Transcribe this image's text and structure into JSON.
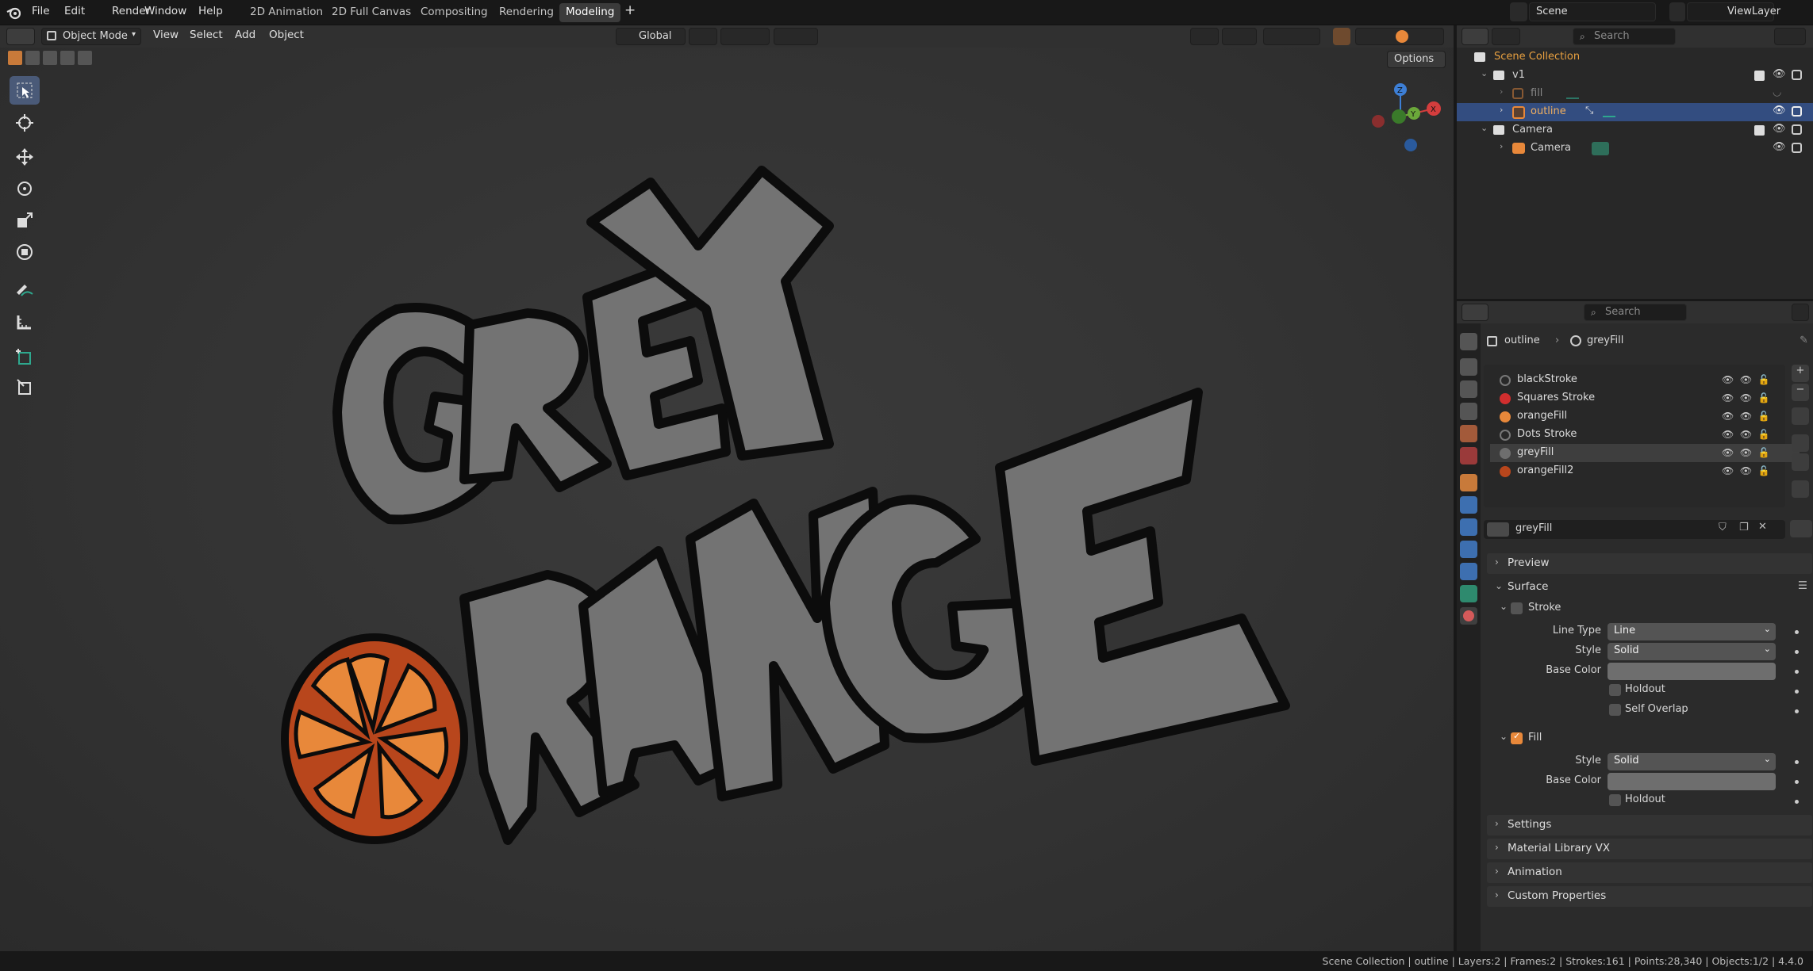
{
  "menu": [
    "File",
    "Edit",
    "Render",
    "Window",
    "Help"
  ],
  "workspaces": [
    "2D Animation",
    "2D Full Canvas",
    "Compositing",
    "Rendering",
    "Modeling"
  ],
  "active_workspace": "Modeling",
  "add_tab": "+",
  "scene": {
    "label": "Scene",
    "view_layer": "ViewLayer"
  },
  "viewport_header": {
    "mode": "Object Mode",
    "menus": [
      "View",
      "Select",
      "Add",
      "Object"
    ],
    "orientation": "Global",
    "options": "Options"
  },
  "gizmo": {
    "z": "Z",
    "y": "Y",
    "x": "X"
  },
  "outliner": {
    "search_placeholder": "Search",
    "rows": [
      {
        "label": "Scene Collection"
      },
      {
        "label": "v1"
      },
      {
        "label": "fill"
      },
      {
        "label": "outline"
      },
      {
        "label": "Camera"
      },
      {
        "label": "Camera"
      }
    ]
  },
  "properties": {
    "search_placeholder": "Search",
    "breadcrumb": {
      "object": "outline",
      "material": "greyFill"
    },
    "materials": [
      {
        "name": "blackStroke",
        "color": "#1a1a1a"
      },
      {
        "name": "Squares Stroke",
        "color": "#d12e2e"
      },
      {
        "name": "orangeFill",
        "color": "#e8883a"
      },
      {
        "name": "Dots Stroke",
        "color": "#1a1a1a"
      },
      {
        "name": "greyFill",
        "color": "#6e6e6e"
      },
      {
        "name": "orangeFill2",
        "color": "#b8461c"
      }
    ],
    "active_material": "greyFill",
    "sections": {
      "preview": "Preview",
      "surface": "Surface",
      "stroke": "Stroke",
      "fill": "Fill",
      "settings": "Settings",
      "library": "Material Library VX",
      "animation": "Animation",
      "custom": "Custom Properties"
    },
    "stroke": {
      "line_type_label": "Line Type",
      "line_type": "Line",
      "style_label": "Style",
      "style": "Solid",
      "base_color_label": "Base Color",
      "base_color": "#6e6e6e",
      "holdout": "Holdout",
      "self_overlap": "Self Overlap"
    },
    "fill": {
      "style_label": "Style",
      "style": "Solid",
      "base_color_label": "Base Color",
      "base_color": "#6e6e6e",
      "holdout": "Holdout"
    }
  },
  "artwork": {
    "word1": "GREY",
    "word2": "RANGE",
    "grey": "#737373",
    "orange_rim": "#b8461c",
    "orange_segment": "#e8883a"
  },
  "status": "Scene Collection | outline | Layers:2 | Frames:2 | Strokes:161 | Points:28,340 | Objects:1/2 | 4.4.0"
}
